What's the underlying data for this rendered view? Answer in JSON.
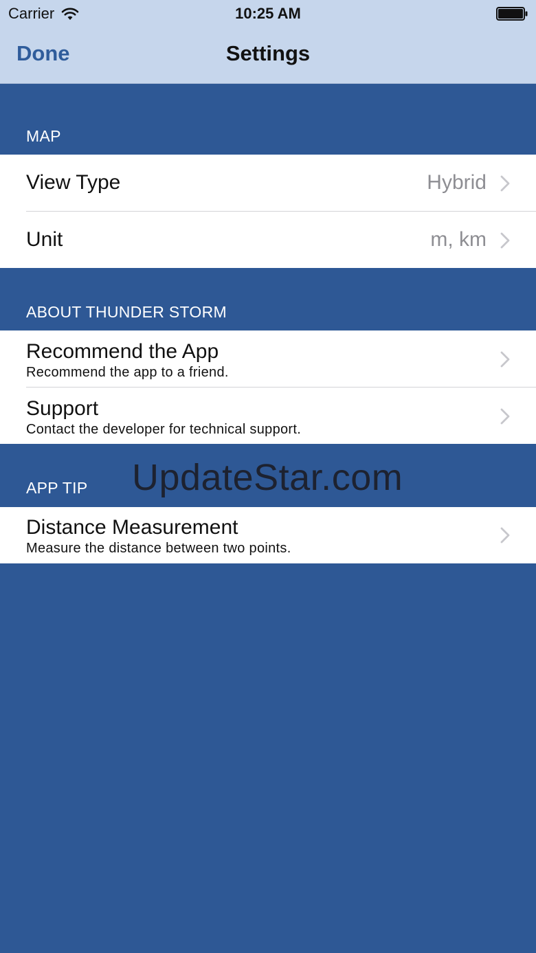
{
  "status_bar": {
    "carrier": "Carrier",
    "time": "10:25 AM",
    "wifi_icon": "wifi-icon",
    "battery_icon": "battery-icon"
  },
  "nav": {
    "done_label": "Done",
    "title": "Settings"
  },
  "sections": {
    "map": {
      "header": "MAP",
      "items": [
        {
          "title": "View Type",
          "value": "Hybrid"
        },
        {
          "title": "Unit",
          "value": "m, km"
        }
      ]
    },
    "about": {
      "header": "ABOUT THUNDER STORM",
      "items": [
        {
          "title": "Recommend the App",
          "subtitle": "Recommend the app to a friend."
        },
        {
          "title": "Support",
          "subtitle": "Contact the developer for technical support."
        }
      ]
    },
    "tip": {
      "header": "APP TIP",
      "items": [
        {
          "title": "Distance Measurement",
          "subtitle": "Measure the distance between two points."
        }
      ]
    }
  },
  "watermark": "UpdateStar.com",
  "colors": {
    "background": "#2e5895",
    "nav_bar": "#c6d6ec",
    "accent": "#2f5c9b",
    "value_gray": "#8e8e93"
  }
}
